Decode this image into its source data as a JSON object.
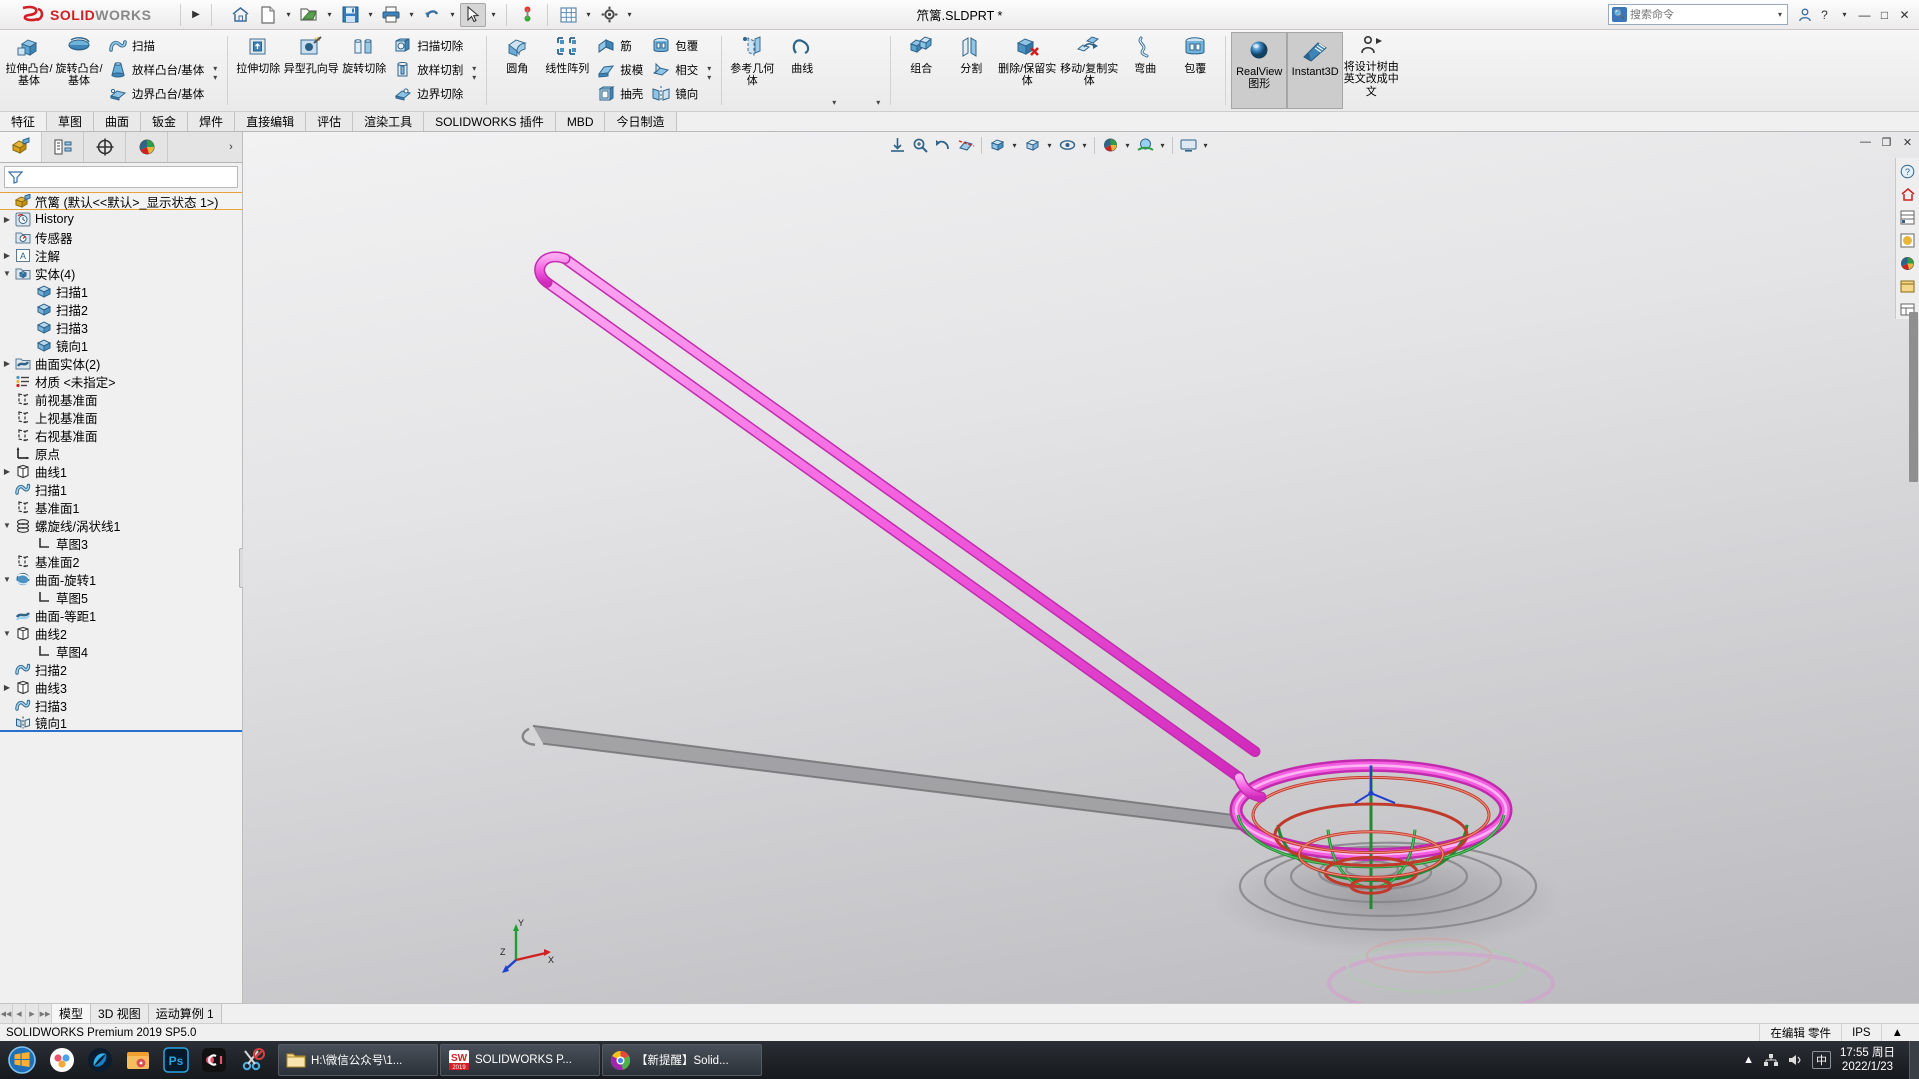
{
  "titlebar": {
    "brand_ds": "3DS",
    "brand_solid": "SOLID",
    "brand_works": "WORKS",
    "expand_arrow": "▶",
    "doc_title": "笊篱.SLDPRT *",
    "quick_access": [
      {
        "name": "home-icon",
        "label": "主页"
      },
      {
        "name": "new-document-icon",
        "label": "新建"
      },
      {
        "name": "open-document-icon",
        "label": "打开"
      },
      {
        "name": "save-icon",
        "label": "保存"
      },
      {
        "name": "print-icon",
        "label": "打印"
      },
      {
        "name": "undo-icon",
        "label": "撤销"
      },
      {
        "name": "select-cursor-icon",
        "label": "选择"
      },
      {
        "name": "rebuild-icon",
        "label": "重建模型"
      },
      {
        "name": "options-grid-icon",
        "label": "选项表"
      },
      {
        "name": "gear-icon",
        "label": "选项"
      }
    ],
    "search_placeholder": "搜索命令",
    "search_value": "",
    "help_icon": "?",
    "user_icon": "👤",
    "minimize": "—",
    "maximize": "□",
    "close": "✕"
  },
  "ribbon": {
    "groups": [
      {
        "name": "boss-base",
        "big": [
          {
            "label": "拉伸凸台/基体",
            "icon": "extrude-boss-icon",
            "caret": true
          },
          {
            "label": "旋转凸台/基体",
            "icon": "revolve-boss-icon",
            "caret": true
          }
        ],
        "rows": [
          {
            "label": "扫描",
            "icon": "sweep-icon"
          },
          {
            "label": "放样凸台/基体",
            "icon": "loft-icon"
          },
          {
            "label": "边界凸台/基体",
            "icon": "boundary-boss-icon"
          }
        ]
      },
      {
        "name": "cut",
        "big": [
          {
            "label": "拉伸切除",
            "icon": "extrude-cut-icon",
            "caret": true
          },
          {
            "label": "异型孔向导",
            "icon": "hole-wizard-icon",
            "caret": true
          },
          {
            "label": "旋转切除",
            "icon": "revolve-cut-icon",
            "caret": false
          }
        ],
        "rows": [
          {
            "label": "扫描切除",
            "icon": "sweep-cut-icon"
          },
          {
            "label": "放样切割",
            "icon": "loft-cut-icon"
          },
          {
            "label": "边界切除",
            "icon": "boundary-cut-icon"
          }
        ]
      },
      {
        "name": "features",
        "big": [
          {
            "label": "圆角",
            "icon": "fillet-icon",
            "caret": true
          },
          {
            "label": "线性阵列",
            "icon": "linear-pattern-icon",
            "caret": true
          }
        ],
        "rows": [
          {
            "label": "筋",
            "icon": "rib-icon"
          },
          {
            "label": "拔模",
            "icon": "draft-icon"
          },
          {
            "label": "抽壳",
            "icon": "shell-icon"
          }
        ],
        "rows2": [
          {
            "label": "包覆",
            "icon": "wrap-icon"
          },
          {
            "label": "相交",
            "icon": "intersect-icon"
          },
          {
            "label": "镜向",
            "icon": "mirror-icon"
          }
        ]
      },
      {
        "name": "reference",
        "big": [
          {
            "label": "参考几何体",
            "icon": "reference-geometry-icon",
            "caret": true
          },
          {
            "label": "曲线",
            "icon": "curves-icon",
            "caret": true
          }
        ]
      },
      {
        "name": "bodies",
        "big": [
          {
            "label": "组合",
            "icon": "combine-icon",
            "caret": false
          },
          {
            "label": "分割",
            "icon": "split-icon",
            "caret": false
          },
          {
            "label": "删除/保留实体",
            "icon": "delete-keep-body-icon",
            "caret": false
          },
          {
            "label": "移动/复制实体",
            "icon": "move-copy-body-icon",
            "caret": false
          },
          {
            "label": "弯曲",
            "icon": "flex-icon",
            "caret": false
          },
          {
            "label": "包覆",
            "icon": "wrap-big-icon",
            "caret": false
          }
        ]
      },
      {
        "name": "display",
        "toggles": [
          {
            "label": "RealView 图形",
            "icon": "realview-sphere-icon",
            "active": true
          },
          {
            "label": "Instant3D",
            "icon": "instant3d-ruler-icon",
            "active": true
          }
        ],
        "big": [
          {
            "label": "将设计树由英文改成中文",
            "icon": "translate-tree-icon",
            "caret": false
          }
        ]
      }
    ]
  },
  "command_tabs": [
    {
      "label": "特征",
      "active": true
    },
    {
      "label": "草图",
      "active": false
    },
    {
      "label": "曲面",
      "active": false
    },
    {
      "label": "钣金",
      "active": false
    },
    {
      "label": "焊件",
      "active": false
    },
    {
      "label": "直接编辑",
      "active": false
    },
    {
      "label": "评估",
      "active": false
    },
    {
      "label": "渲染工具",
      "active": false
    },
    {
      "label": "SOLIDWORKS 插件",
      "active": false
    },
    {
      "label": "MBD",
      "active": false
    },
    {
      "label": "今日制造",
      "active": false
    }
  ],
  "feature_manager": {
    "tabs": [
      {
        "name": "featuremanager-design-tree-tab",
        "icon": "feature-tree-icon",
        "active": true
      },
      {
        "name": "property-manager-tab",
        "icon": "property-manager-icon",
        "active": false
      },
      {
        "name": "configuration-manager-tab",
        "icon": "configuration-icon",
        "active": false
      },
      {
        "name": "display-manager-tab",
        "icon": "display-manager-icon",
        "active": false
      }
    ],
    "more_arrow": "›",
    "filter_placeholder": "",
    "filter_value": "",
    "root": {
      "icon": "part-icon",
      "label": "笊篱  (默认<<默认>_显示状态 1>)"
    },
    "tree": [
      {
        "indent": 0,
        "expander": "▶",
        "icon": "history-icon",
        "label": "History"
      },
      {
        "indent": 0,
        "expander": "",
        "icon": "sensors-icon",
        "label": "传感器"
      },
      {
        "indent": 0,
        "expander": "▶",
        "icon": "annotations-icon",
        "label": "注解"
      },
      {
        "indent": 0,
        "expander": "▼",
        "icon": "solid-bodies-icon",
        "label": "实体(4)"
      },
      {
        "indent": 1,
        "expander": "",
        "icon": "body-icon",
        "label": "扫描1"
      },
      {
        "indent": 1,
        "expander": "",
        "icon": "body-icon",
        "label": "扫描2"
      },
      {
        "indent": 1,
        "expander": "",
        "icon": "body-icon",
        "label": "扫描3"
      },
      {
        "indent": 1,
        "expander": "",
        "icon": "body-icon",
        "label": "镜向1"
      },
      {
        "indent": 0,
        "expander": "▶",
        "icon": "surface-bodies-icon",
        "label": "曲面实体(2)"
      },
      {
        "indent": 0,
        "expander": "",
        "icon": "material-icon",
        "label": "材质 <未指定>"
      },
      {
        "indent": 0,
        "expander": "",
        "icon": "plane-icon",
        "label": "前视基准面"
      },
      {
        "indent": 0,
        "expander": "",
        "icon": "plane-icon",
        "label": "上视基准面"
      },
      {
        "indent": 0,
        "expander": "",
        "icon": "plane-icon",
        "label": "右视基准面"
      },
      {
        "indent": 0,
        "expander": "",
        "icon": "origin-icon",
        "label": "原点"
      },
      {
        "indent": 0,
        "expander": "▶",
        "icon": "curve-icon",
        "label": "曲线1"
      },
      {
        "indent": 0,
        "expander": "",
        "icon": "sweep-feature-icon",
        "label": "扫描1"
      },
      {
        "indent": 0,
        "expander": "",
        "icon": "plane-icon",
        "label": "基准面1"
      },
      {
        "indent": 0,
        "expander": "▼",
        "icon": "helix-icon",
        "label": "螺旋线/涡状线1"
      },
      {
        "indent": 1,
        "expander": "",
        "icon": "sketch-icon",
        "label": "草图3"
      },
      {
        "indent": 0,
        "expander": "",
        "icon": "plane-icon",
        "label": "基准面2"
      },
      {
        "indent": 0,
        "expander": "▼",
        "icon": "surface-revolve-icon",
        "label": "曲面-旋转1"
      },
      {
        "indent": 1,
        "expander": "",
        "icon": "sketch-icon",
        "label": "草图5"
      },
      {
        "indent": 0,
        "expander": "",
        "icon": "surface-offset-icon",
        "label": "曲面-等距1"
      },
      {
        "indent": 0,
        "expander": "▼",
        "icon": "curve-icon",
        "label": "曲线2"
      },
      {
        "indent": 1,
        "expander": "",
        "icon": "sketch-icon",
        "label": "草图4"
      },
      {
        "indent": 0,
        "expander": "",
        "icon": "sweep-feature-icon",
        "label": "扫描2"
      },
      {
        "indent": 0,
        "expander": "▶",
        "icon": "curve-icon",
        "label": "曲线3"
      },
      {
        "indent": 0,
        "expander": "",
        "icon": "sweep-feature-icon",
        "label": "扫描3"
      },
      {
        "indent": 0,
        "expander": "",
        "icon": "mirror-feature-icon",
        "label": "镜向1",
        "rollbar": true
      }
    ]
  },
  "view_toolbar": [
    {
      "name": "zoom-to-fit-icon",
      "label": "整屏显示全图"
    },
    {
      "name": "zoom-area-icon",
      "label": "局部放大"
    },
    {
      "name": "previous-view-icon",
      "label": "上一视图"
    },
    {
      "name": "section-view-icon",
      "label": "剖面视图"
    },
    {
      "name": "view-orientation-icon",
      "label": "视图定向",
      "caret": true
    },
    {
      "name": "display-style-icon",
      "label": "显示样式",
      "caret": true
    },
    {
      "name": "hide-show-items-icon",
      "label": "隐藏/显示项目",
      "caret": true
    },
    {
      "name": "edit-appearance-icon",
      "label": "编辑外观",
      "caret": true
    },
    {
      "name": "apply-scene-icon",
      "label": "应用布景",
      "caret": true
    },
    {
      "name": "view-settings-icon",
      "label": "视图设定",
      "caret": true
    }
  ],
  "gfx_window_buttons": {
    "minimize": "—",
    "restore": "❐",
    "close": "✕"
  },
  "right_dock": [
    {
      "name": "help-dock-icon",
      "label": "?"
    },
    {
      "name": "home-dock-icon",
      "label": "⌂"
    },
    {
      "name": "appearances-dock-icon",
      "label": "外观"
    },
    {
      "name": "scenes-dock-icon",
      "label": "布景"
    },
    {
      "name": "decals-dock-icon",
      "label": "贴图"
    },
    {
      "name": "design-library-dock-icon",
      "label": "设计库"
    },
    {
      "name": "file-explorer-dock-icon",
      "label": "文件探索器"
    }
  ],
  "triad": {
    "x_label": "X",
    "y_label": "Y",
    "z_label": "Z"
  },
  "doc_tabs": {
    "nav": [
      "◀◀",
      "◀",
      "▶",
      "▶▶"
    ],
    "tabs": [
      {
        "label": "模型",
        "active": true
      },
      {
        "label": "3D 视图",
        "active": false
      },
      {
        "label": "运动算例 1",
        "active": false
      }
    ]
  },
  "status_bar": {
    "left": "SOLIDWORKS Premium 2019 SP5.0",
    "editing": "在编辑 零件",
    "units": "IPS",
    "expand": "▲"
  },
  "taskbar": {
    "start": "start-orb-icon",
    "quick_icons": [
      {
        "name": "wps-cloud-icon"
      },
      {
        "name": "browser-icon"
      },
      {
        "name": "media-folder-icon"
      },
      {
        "name": "photoshop-icon",
        "label": "Ps"
      },
      {
        "name": "recorder-icon"
      },
      {
        "name": "snip-scissors-icon"
      }
    ],
    "windows": [
      {
        "name": "explorer-window",
        "icon": "folder-icon",
        "label": "H:\\微信公众号\\1..."
      },
      {
        "name": "solidworks-window",
        "icon": "solidworks-2019-icon",
        "label": "SOLIDWORKS P..."
      },
      {
        "name": "browser-window",
        "icon": "chrome-icon",
        "label": "【新提醒】Solid..."
      }
    ],
    "tray": [
      {
        "name": "tray-arrow-icon",
        "label": "▲"
      },
      {
        "name": "tray-network-icon",
        "label": "🖧"
      },
      {
        "name": "tray-sound-icon",
        "label": "🔊"
      },
      {
        "name": "tray-input-icon",
        "label": "中"
      }
    ],
    "clock_time": "17:55",
    "clock_day": "周日",
    "clock_date": "2022/1/23"
  }
}
